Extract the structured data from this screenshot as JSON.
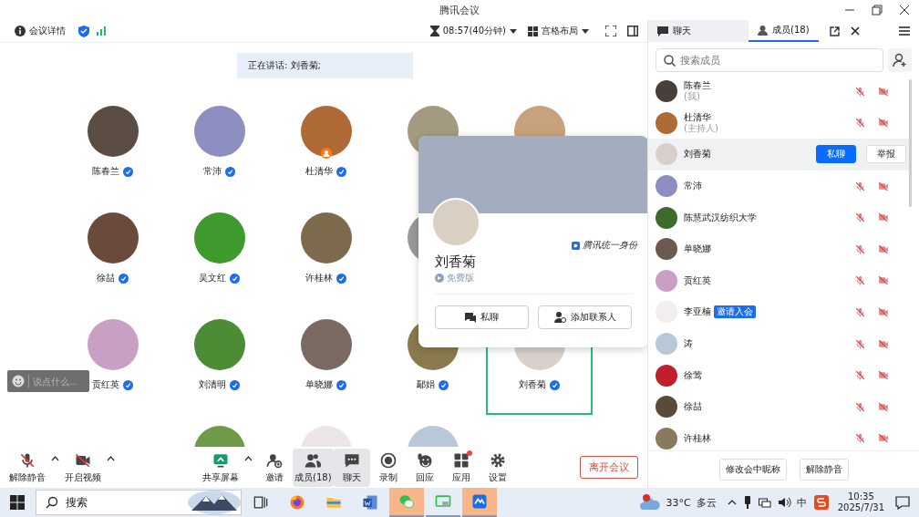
{
  "window": {
    "title": "腾讯会议"
  },
  "toolbar": {
    "info": "会议详情",
    "timer": "08:57(40分钟)",
    "layout": "宫格布局"
  },
  "speaking_banner": "正在讲话: 刘香菊;",
  "tiles": [
    {
      "kind": "person",
      "name": "陈春兰",
      "host": false,
      "speaking": false
    },
    {
      "kind": "person",
      "name": "常沛",
      "host": false,
      "speaking": false
    },
    {
      "kind": "person",
      "name": "杜清华",
      "host": true,
      "speaking": false
    },
    {
      "kind": "person",
      "host": false,
      "speaking": false
    },
    {
      "kind": "person",
      "host": false,
      "speaking": false
    },
    {
      "kind": "person",
      "name": "徐喆",
      "host": false,
      "speaking": false
    },
    {
      "kind": "person",
      "name": "吴文红",
      "host": false,
      "speaking": false
    },
    {
      "kind": "person",
      "name": "许桂林",
      "host": false,
      "speaking": false
    },
    {
      "kind": "person",
      "host": false,
      "speaking": false
    },
    {
      "kind": "empty"
    },
    {
      "kind": "person",
      "name": "贡红英",
      "host": false,
      "speaking": false
    },
    {
      "kind": "person",
      "name": "刘清明",
      "host": false,
      "speaking": false
    },
    {
      "kind": "person",
      "name": "单晓娜",
      "host": false,
      "speaking": false
    },
    {
      "kind": "person",
      "name": "鄢娟",
      "host": false,
      "speaking": false
    },
    {
      "kind": "person",
      "name": "刘香菊",
      "host": false,
      "speaking": true
    },
    {
      "kind": "empty"
    },
    {
      "kind": "person",
      "host": false,
      "speaking": false
    },
    {
      "kind": "person",
      "host": false,
      "speaking": false
    },
    {
      "kind": "person",
      "host": false,
      "speaking": false
    }
  ],
  "chat_input": {
    "placeholder": "说点什么..."
  },
  "profile_card": {
    "identity": "腾讯统一身份",
    "name": "刘香菊",
    "plan": "免费版",
    "buttons": [
      "私聊",
      "添加联系人"
    ]
  },
  "panel": {
    "tabs": [
      {
        "label": "聊天",
        "selected": false
      },
      {
        "label": "成员(18)",
        "selected": true
      }
    ],
    "search": {
      "placeholder": "搜索成员"
    },
    "row_actions": [
      "私聊",
      "举报"
    ],
    "members": [
      {
        "name": "陈春兰",
        "role": "(我)",
        "selected": false
      },
      {
        "name": "杜清华",
        "role": "(主持人)",
        "selected": false
      },
      {
        "name": "刘香菊",
        "selected": true
      },
      {
        "name": "常沛",
        "selected": false
      },
      {
        "name": "陈慧武汉纺织大学",
        "selected": false
      },
      {
        "name": "单晓娜",
        "selected": false
      },
      {
        "name": "贡红英",
        "selected": false
      },
      {
        "name": "李亚楠",
        "badge": "邀请入会",
        "selected": false
      },
      {
        "name": "涛",
        "selected": false
      },
      {
        "name": "徐莺",
        "selected": false
      },
      {
        "name": "徐喆",
        "selected": false
      },
      {
        "name": "许桂林",
        "selected": false
      }
    ],
    "footer_buttons": [
      "修改会中昵称",
      "解除静音"
    ]
  },
  "bottom_toolbar": {
    "items": [
      {
        "label": "解除静音",
        "caret": true,
        "active": false,
        "dot": false
      },
      {
        "label": "开启视频",
        "caret": true,
        "active": false,
        "dot": false
      },
      {
        "label": "共享屏幕",
        "caret": true,
        "active": false,
        "dot": false
      },
      {
        "label": "邀请",
        "caret": false,
        "active": false,
        "dot": false
      },
      {
        "label": "成员(18)",
        "caret": false,
        "active": true,
        "dot": false
      },
      {
        "label": "聊天",
        "caret": false,
        "active": true,
        "dot": false
      },
      {
        "label": "录制",
        "caret": false,
        "active": false,
        "dot": false
      },
      {
        "label": "回应",
        "caret": false,
        "active": false,
        "dot": false
      },
      {
        "label": "应用",
        "caret": false,
        "active": false,
        "dot": true
      },
      {
        "label": "设置",
        "caret": false,
        "active": false,
        "dot": false
      }
    ],
    "leave": "离开会议"
  },
  "taskbar": {
    "search": {
      "placeholder": "搜索"
    },
    "apps": [
      {
        "highlighted": false,
        "running": false
      },
      {
        "highlighted": false,
        "running": false
      },
      {
        "highlighted": false,
        "running": false
      },
      {
        "highlighted": false,
        "running": false
      },
      {
        "highlighted": true,
        "running": true
      },
      {
        "highlighted": false,
        "running": true
      },
      {
        "highlighted": true,
        "running": true
      }
    ],
    "weather": "33°C",
    "weather_text": "多云",
    "ime": "中",
    "time": "10:35",
    "date": "2025/7/31"
  }
}
